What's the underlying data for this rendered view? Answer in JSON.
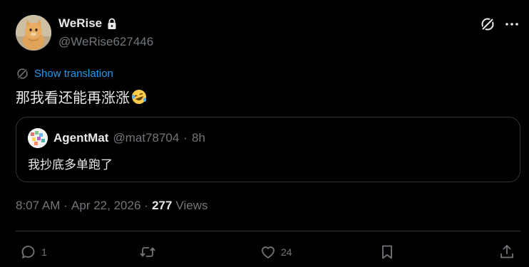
{
  "author": {
    "display_name": "WeRise",
    "handle": "@WeRise627446",
    "protected": true
  },
  "translation": {
    "label": "Show translation"
  },
  "tweet": {
    "text": "那我看还能再涨涨"
  },
  "quote": {
    "display_name": "AgentMat",
    "handle": "@mat78704",
    "separator": "·",
    "time": "8h",
    "text": "我抄底多单跑了"
  },
  "meta": {
    "time": "8:07 AM",
    "sep1": "·",
    "date": "Apr 22, 2026",
    "sep2": "·",
    "views_count": "277",
    "views_label": "Views"
  },
  "actions": {
    "replies": "1",
    "retweets": "",
    "likes": "24"
  },
  "colors": {
    "background": "#000000",
    "text": "#e7e9ea",
    "secondary": "#71767b",
    "link": "#1d9bf0",
    "border": "#2f3336"
  },
  "icons": [
    "lock-icon",
    "grok-icon",
    "more-icon",
    "translate-icon",
    "laughing-emoji",
    "reply-icon",
    "retweet-icon",
    "like-icon",
    "bookmark-icon",
    "share-icon"
  ]
}
